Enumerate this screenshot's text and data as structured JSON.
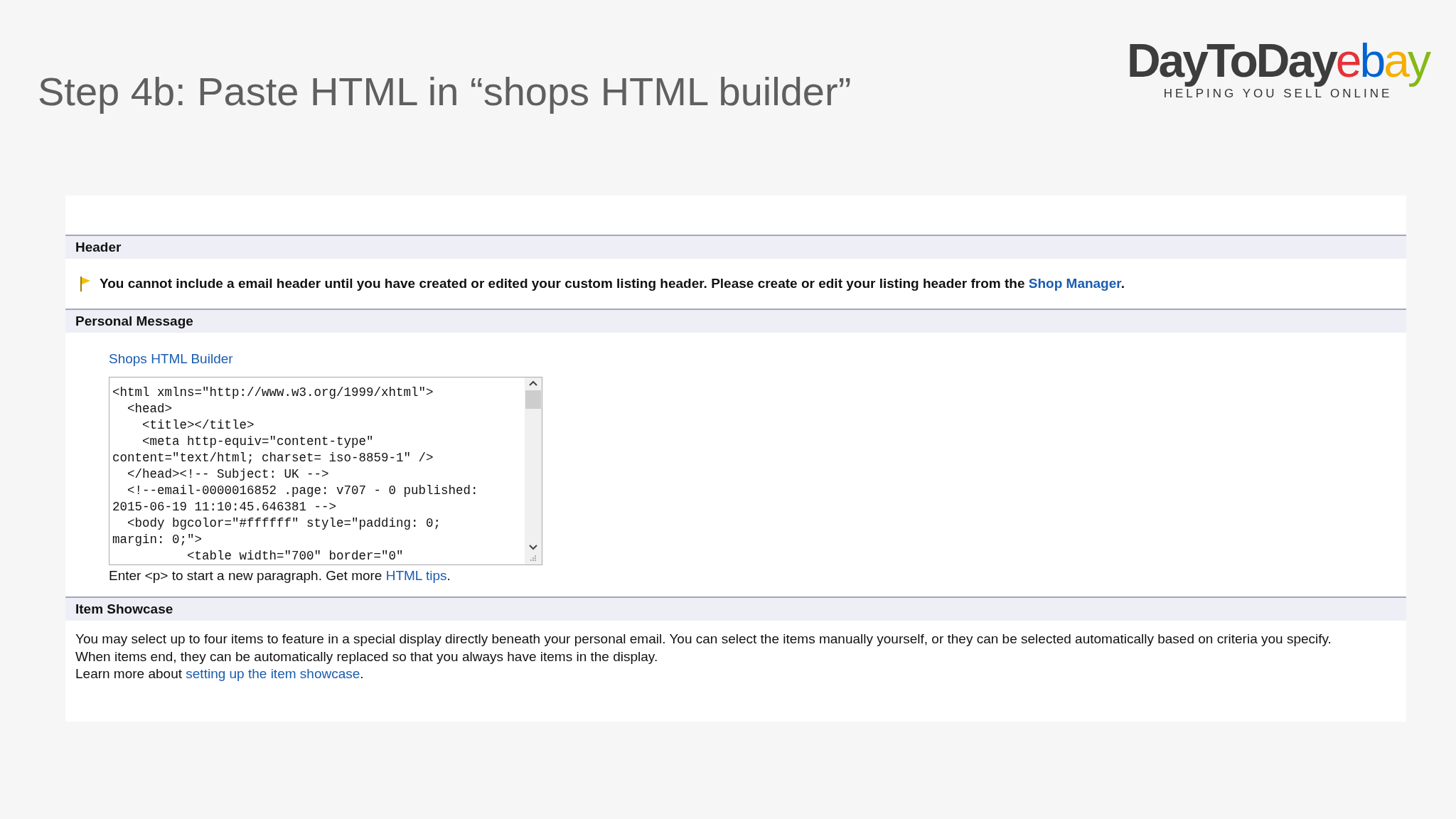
{
  "slide_title": "Step 4b: Paste HTML in “shops HTML builder”",
  "logo": {
    "wordmark": "DayToDay",
    "ebay_letters": [
      {
        "text": "e",
        "color": "#e53238"
      },
      {
        "text": "b",
        "color": "#0064d2"
      },
      {
        "text": "a",
        "color": "#f5af02"
      },
      {
        "text": "y",
        "color": "#86b817"
      }
    ],
    "tagline": "HELPING YOU SELL ONLINE"
  },
  "sections": [
    {
      "heading": "Header",
      "kind": "notice",
      "notice": "You cannot include a email header until you have created or edited your custom listing header. Please create or edit your listing header from the",
      "notice_link": "Shop Manager",
      "notice_end": "."
    },
    {
      "heading": "Personal Message",
      "kind": "editor",
      "link": "Shops HTML Builder",
      "code_lines": [
        "<html xmlns=\"http://www.w3.org/1999/xhtml\">",
        "  <head>",
        "    <title></title>",
        "    <meta http-equiv=\"content-type\"",
        "content=\"text/html; charset= iso-8859-1\" />",
        "  </head><!-- Subject: UK -->",
        "  <!--email-0000016852 .page: v707 - 0 published:",
        "2015-06-19 11:10:45.646381 -->",
        "  <body bgcolor=\"#ffffff\" style=\"padding: 0;",
        "margin: 0;\">",
        "          <table width=\"700\" border=\"0\""
      ],
      "hint": "Enter <p> to start a new paragraph. Get more",
      "hint_link": "HTML tips",
      "hint_end": "."
    },
    {
      "heading": "Item Showcase",
      "kind": "text",
      "lines": [
        "You may select up to four items to feature in a special display directly beneath your personal email. You can select the items manually yourself, or they can be selected automatically based on criteria you specify.",
        "When items end, they can be automatically replaced so that you always have items in the display."
      ],
      "learn": "Learn more about",
      "learn_link": "setting up the item showcase",
      "learn_end": "."
    }
  ]
}
